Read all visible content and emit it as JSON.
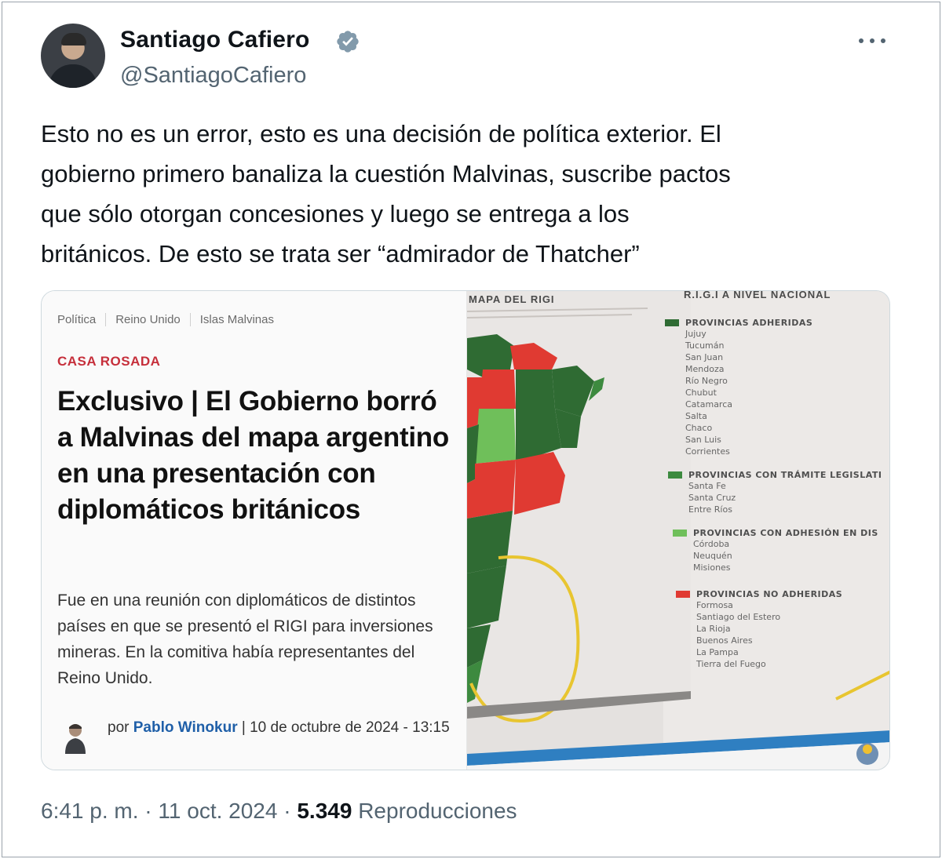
{
  "tweet": {
    "display_name": "Santiago Cafiero",
    "handle": "@SantiagoCafiero",
    "verified_icon": "verified-badge-icon",
    "more_icon": "more-horizontal-icon",
    "text": "Esto no es un error, esto es una decisión de política exterior. El\ngobierno primero banaliza la cuestión Malvinas, suscribe pactos\nque sólo otorgan concesiones y luego se entrega a los\nbritánicos. De esto se trata ser “admirador de Thatcher”",
    "time": "6:41 p. m.",
    "separator1": " · ",
    "date": "11 oct. 2024",
    "separator2": " · ",
    "views_count": "5.349",
    "views_label": " Reproducciones"
  },
  "article": {
    "crumbs": [
      "Política",
      "Reino Unido",
      "Islas Malvinas"
    ],
    "section": "CASA ROSADA",
    "headline": "Exclusivo | El Gobierno borró a Malvinas del mapa argentino en una presentación con diplomáticos británicos",
    "lede": "Fue en una reunión con diplomáticos de distintos países en que se presentó el RIGI para inversiones mineras. En la comitiva había representantes del Reino Unido.",
    "byline_prefix": "por ",
    "author": "Pablo Winokur",
    "byline_suffix": " | 10 de octubre de 2024 - 13:15"
  },
  "photo": {
    "map_title": "MAPA DEL RIGI",
    "legend_title": "R.I.G.I A NIVEL NACIONAL",
    "groups": [
      {
        "title": "PROVINCIAS ADHERIDAS",
        "color": "#2f6b33",
        "items": [
          "Jujuy",
          "Tucumán",
          "San Juan",
          "Mendoza",
          "Río Negro",
          "Chubut",
          "Catamarca",
          "Salta",
          "Chaco",
          "San Luis",
          "Corrientes"
        ]
      },
      {
        "title": "PROVINCIAS CON TRÁMITE LEGISLATI",
        "color": "#3d8a3f",
        "items": [
          "Santa Fe",
          "Santa Cruz",
          "Entre Ríos"
        ]
      },
      {
        "title": "PROVINCIAS CON ADHESIÓN EN DIS",
        "color": "#6fbf5a",
        "items": [
          "Córdoba",
          "Neuquén",
          "Misiones"
        ]
      },
      {
        "title": "PROVINCIAS NO ADHERIDAS",
        "color": "#e03a32",
        "items": [
          "Formosa",
          "Santiago del Estero",
          "La Rioja",
          "Buenos Aires",
          "La Pampa",
          "Tierra del Fuego"
        ]
      }
    ]
  }
}
